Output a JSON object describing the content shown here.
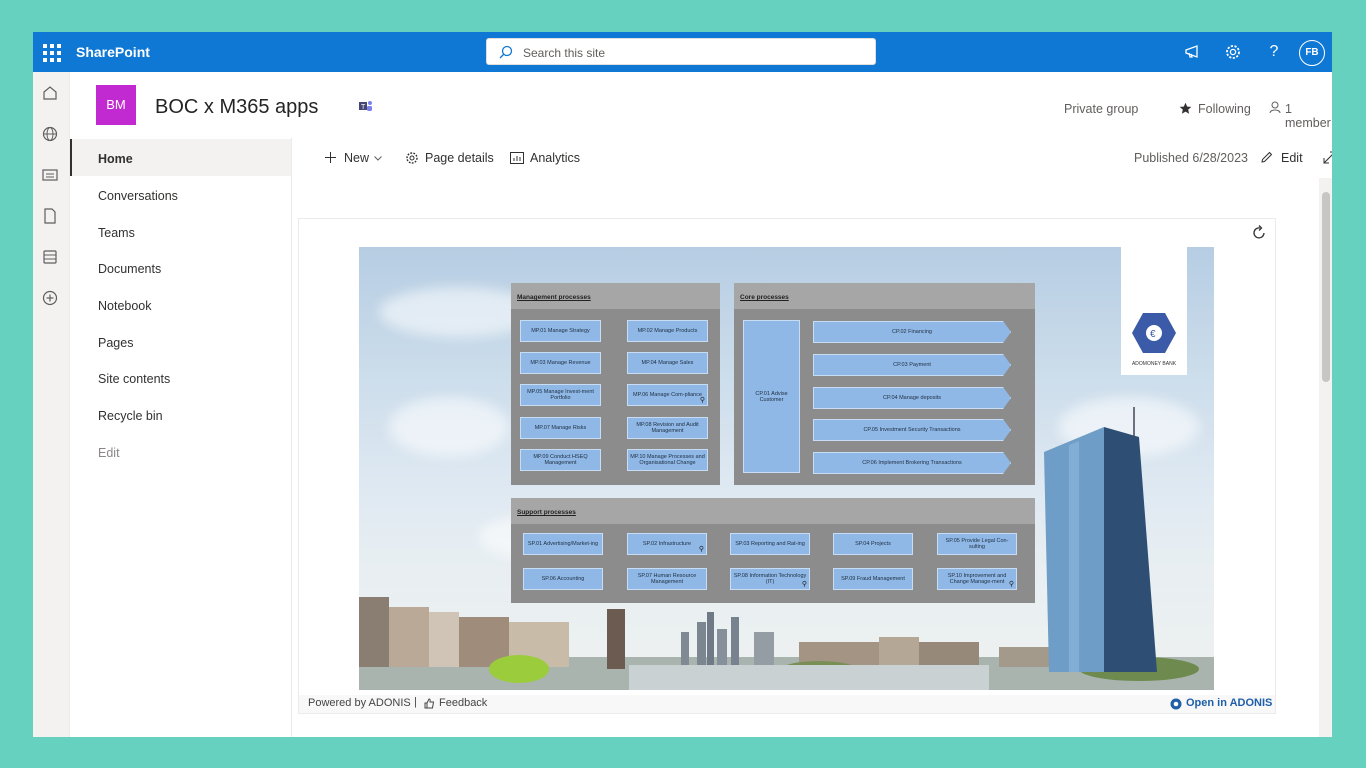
{
  "suite": {
    "brand": "SharePoint",
    "search_placeholder": "Search this site",
    "avatar_initials": "FB"
  },
  "site": {
    "logo_initials": "BM",
    "title": "BOC x M365 apps",
    "privacy": "Private group",
    "following": "Following",
    "members": "1 member"
  },
  "nav": {
    "items": [
      {
        "label": "Home"
      },
      {
        "label": "Conversations"
      },
      {
        "label": "Teams"
      },
      {
        "label": "Documents"
      },
      {
        "label": "Notebook"
      },
      {
        "label": "Pages"
      },
      {
        "label": "Site contents"
      },
      {
        "label": "Recycle bin"
      },
      {
        "label": "Edit"
      }
    ]
  },
  "commandbar": {
    "new": "New",
    "page_details": "Page details",
    "analytics": "Analytics",
    "published": "Published 6/28/2023",
    "edit": "Edit"
  },
  "diagram": {
    "logo_text": "ADOMONEY BANK",
    "management": {
      "title": "Management processes",
      "items": [
        "MP.01 Manage Strategy",
        "MP.02 Manage Products",
        "MP.03 Manage Revenue",
        "MP.04 Manage Sales",
        "MP.05 Manage Invest-ment Portfolio",
        "MP.06 Manage Com-pliance",
        "MP.07 Manage Risks",
        "MP.08 Revision and Audit Management",
        "MP.09 Conduct HSEQ Management",
        "MP.10 Manage Processes and Organisational Change"
      ]
    },
    "core": {
      "title": "Core processes",
      "advise": "CP.01 Advise Customer",
      "items": [
        "CP.02 Financing",
        "CP.03 Payment",
        "CP.04 Manage deposits",
        "CP.05 Investment Security Transactions",
        "CP.06 Implement Brokering Transactions"
      ]
    },
    "support": {
      "title": "Support processes",
      "items": [
        "SP.01 Advertising/Market-ing",
        "SP.02 Infrastructure",
        "SP.03 Reporting and Rat-ing",
        "SP.04 Projects",
        "SP.05 Provide Legal Con-sulting",
        "SP.06 Accounting",
        "SP.07 Human Resource Management",
        "SP.08 Information Technology (IT)",
        "SP.09 Fraud Management",
        "SP.10 Improvement and Change Manage-ment"
      ]
    }
  },
  "webpart_footer": {
    "powered_by": "Powered by ADONIS",
    "feedback": "Feedback",
    "open": "Open in ADONIS"
  },
  "colors": {
    "suitebar": "#0f78d4",
    "logo_bg": "#c22ad1",
    "page_bg": "#66d1bf",
    "box": "#8fb8e6",
    "panel": "#8c8c8c"
  }
}
